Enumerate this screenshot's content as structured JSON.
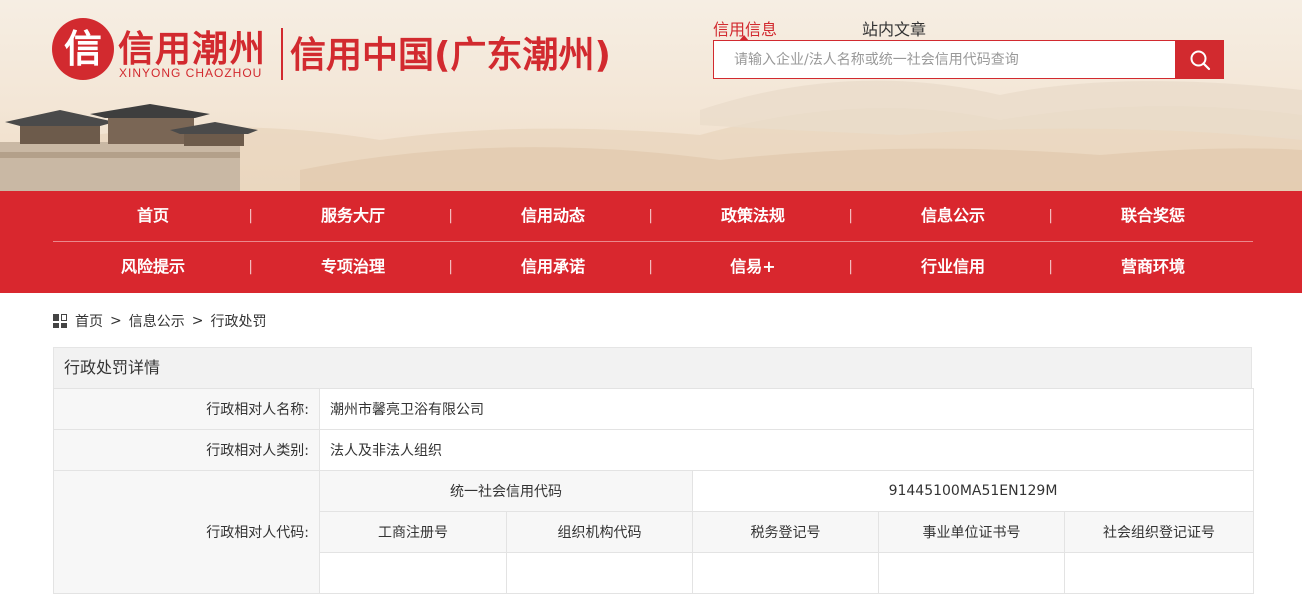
{
  "header": {
    "logo_mark": "信",
    "logo_title": "信用潮州",
    "logo_subtitle": "XINYONG CHAOZHOU",
    "site_title": "信用中国(广东潮州)",
    "search_tabs": [
      "信用信息",
      "站内文章"
    ],
    "search_placeholder": "请输入企业/法人名称或统一社会信用代码查询"
  },
  "nav": {
    "row1": [
      "首页",
      "服务大厅",
      "信用动态",
      "政策法规",
      "信息公示",
      "联合奖惩"
    ],
    "row2": [
      "风险提示",
      "专项治理",
      "信用承诺",
      "信易+",
      "行业信用",
      "营商环境"
    ]
  },
  "breadcrumb": [
    "首页",
    "信息公示",
    "行政处罚"
  ],
  "detail": {
    "title": "行政处罚详情",
    "name_label": "行政相对人名称:",
    "name_value": "潮州市馨亮卫浴有限公司",
    "type_label": "行政相对人类别:",
    "type_value": "法人及非法人组织",
    "code_label": "行政相对人代码:",
    "usci_label": "统一社会信用代码",
    "usci_value": "91445100MA51EN129M",
    "code_columns": [
      "工商注册号",
      "组织机构代码",
      "税务登记号",
      "事业单位证书号",
      "社会组织登记证号"
    ],
    "code_values": [
      "",
      "",
      "",
      "",
      ""
    ]
  },
  "colors": {
    "brand_red": "#d9272e",
    "header_bg": "#f3e6d6"
  }
}
